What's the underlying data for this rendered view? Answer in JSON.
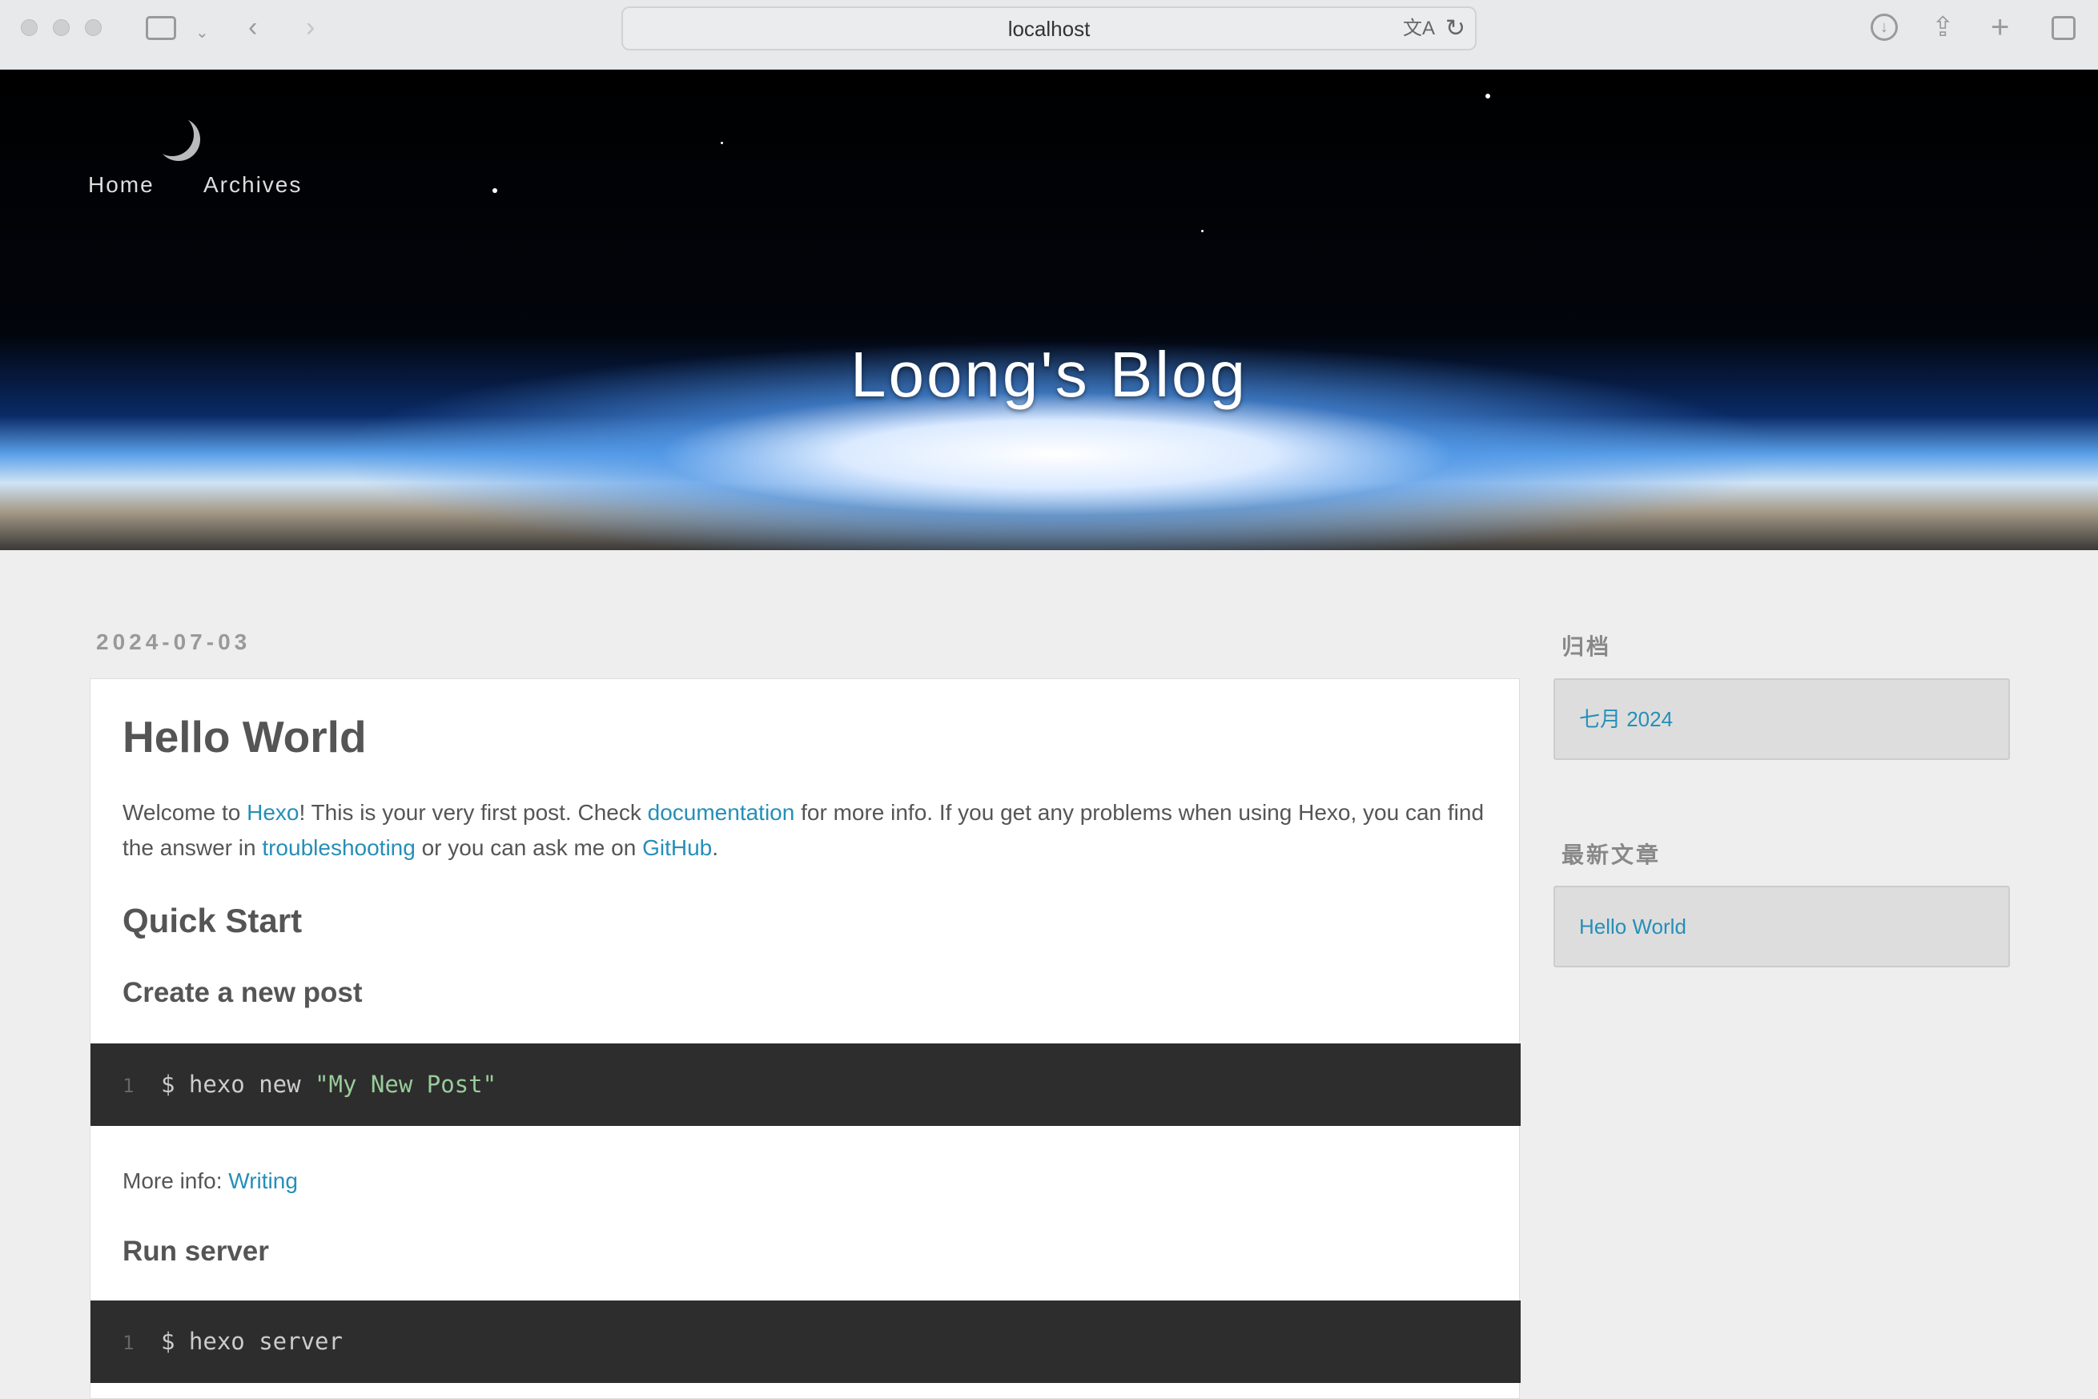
{
  "browser": {
    "url": "localhost"
  },
  "nav": {
    "items": [
      {
        "label": "Home"
      },
      {
        "label": "Archives"
      }
    ]
  },
  "banner": {
    "title": "Loong's Blog"
  },
  "post": {
    "date": "2024-07-03",
    "title": "Hello World",
    "intro": {
      "t1": "Welcome to ",
      "l1": "Hexo",
      "t2": "! This is your very first post. Check ",
      "l2": "documentation",
      "t3": " for more info. If you get any problems when using Hexo, you can find the answer in ",
      "l3": "troubleshooting",
      "t4": " or you can ask me on ",
      "l4": "GitHub",
      "t5": "."
    },
    "quick_start": "Quick Start",
    "create_heading": "Create a new post",
    "code1": {
      "line": "1",
      "cmd": "$ hexo new ",
      "arg": "\"My New Post\""
    },
    "more_info": {
      "label": "More info: ",
      "link": "Writing"
    },
    "run_heading": "Run server",
    "code2": {
      "line": "1",
      "cmd": "$ hexo server"
    }
  },
  "sidebar": {
    "archives": {
      "heading": "归档",
      "items": [
        {
          "label": "七月 2024"
        }
      ]
    },
    "recent": {
      "heading": "最新文章",
      "items": [
        {
          "label": "Hello World"
        }
      ]
    }
  },
  "colors": {
    "link": "#258fb8",
    "code_bg": "#2d2d2d",
    "string": "#99cc99"
  }
}
